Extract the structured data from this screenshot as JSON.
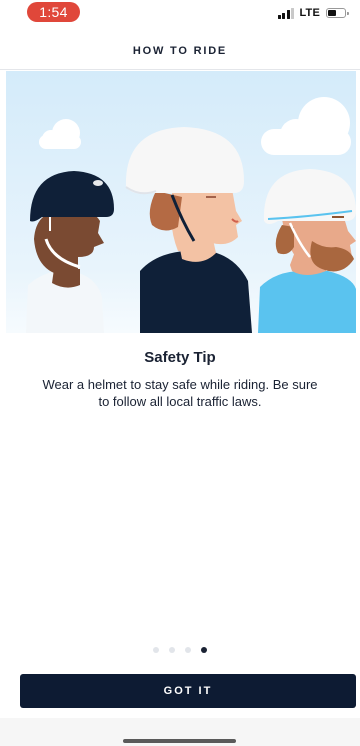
{
  "status_bar": {
    "time": "1:54",
    "network": "LTE",
    "time_pill_color": "#e0473a"
  },
  "header": {
    "title": "HOW TO RIDE"
  },
  "illustration": {
    "description_icon": "helmet-riders-illustration",
    "sky_color": "#dceefb"
  },
  "tip": {
    "title": "Safety Tip",
    "body": "Wear a helmet to stay safe while riding. Be sure to follow all local traffic laws."
  },
  "pagination": {
    "count": 4,
    "active_index": 3
  },
  "actions": {
    "primary_label": "GOT IT",
    "primary_color": "#0d1b33"
  }
}
